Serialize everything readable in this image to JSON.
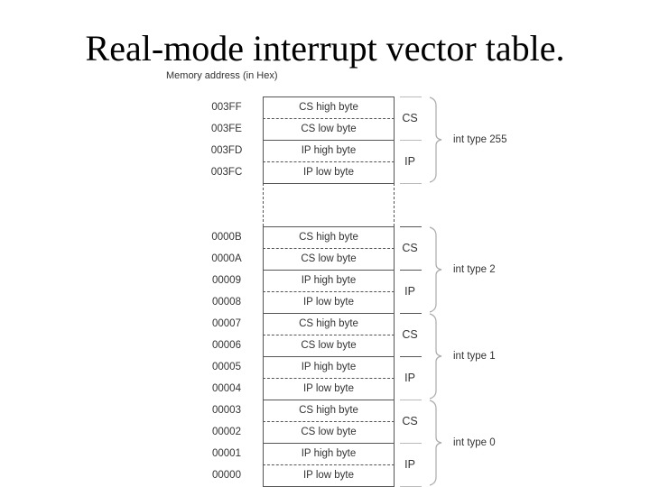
{
  "title": "Real-mode interrupt vector table.",
  "subtitle": "Memory address (in Hex)",
  "top_block": {
    "rows": [
      {
        "address": "003FF",
        "content": "CS high byte"
      },
      {
        "address": "003FE",
        "content": "CS low byte"
      },
      {
        "address": "003FD",
        "content": "IP high byte"
      },
      {
        "address": "003FC",
        "content": "IP low byte"
      }
    ],
    "segments": [
      "CS",
      "IP"
    ],
    "interrupt": "int type 255"
  },
  "bottom_blocks": [
    {
      "rows": [
        {
          "address": "0000B",
          "content": "CS high byte"
        },
        {
          "address": "0000A",
          "content": "CS low byte"
        },
        {
          "address": "00009",
          "content": "IP high byte"
        },
        {
          "address": "00008",
          "content": "IP low byte"
        }
      ],
      "segments": [
        "CS",
        "IP"
      ],
      "interrupt": "int type 2"
    },
    {
      "rows": [
        {
          "address": "00007",
          "content": "CS high byte"
        },
        {
          "address": "00006",
          "content": "CS low byte"
        },
        {
          "address": "00005",
          "content": "IP high byte"
        },
        {
          "address": "00004",
          "content": "IP low byte"
        }
      ],
      "segments": [
        "CS",
        "IP"
      ],
      "interrupt": "int type 1"
    },
    {
      "rows": [
        {
          "address": "00003",
          "content": "CS high byte"
        },
        {
          "address": "00002",
          "content": "CS low byte"
        },
        {
          "address": "00001",
          "content": "IP high byte"
        },
        {
          "address": "00000",
          "content": "IP low byte"
        }
      ],
      "segments": [
        "CS",
        "IP"
      ],
      "interrupt": "int type 0"
    }
  ]
}
